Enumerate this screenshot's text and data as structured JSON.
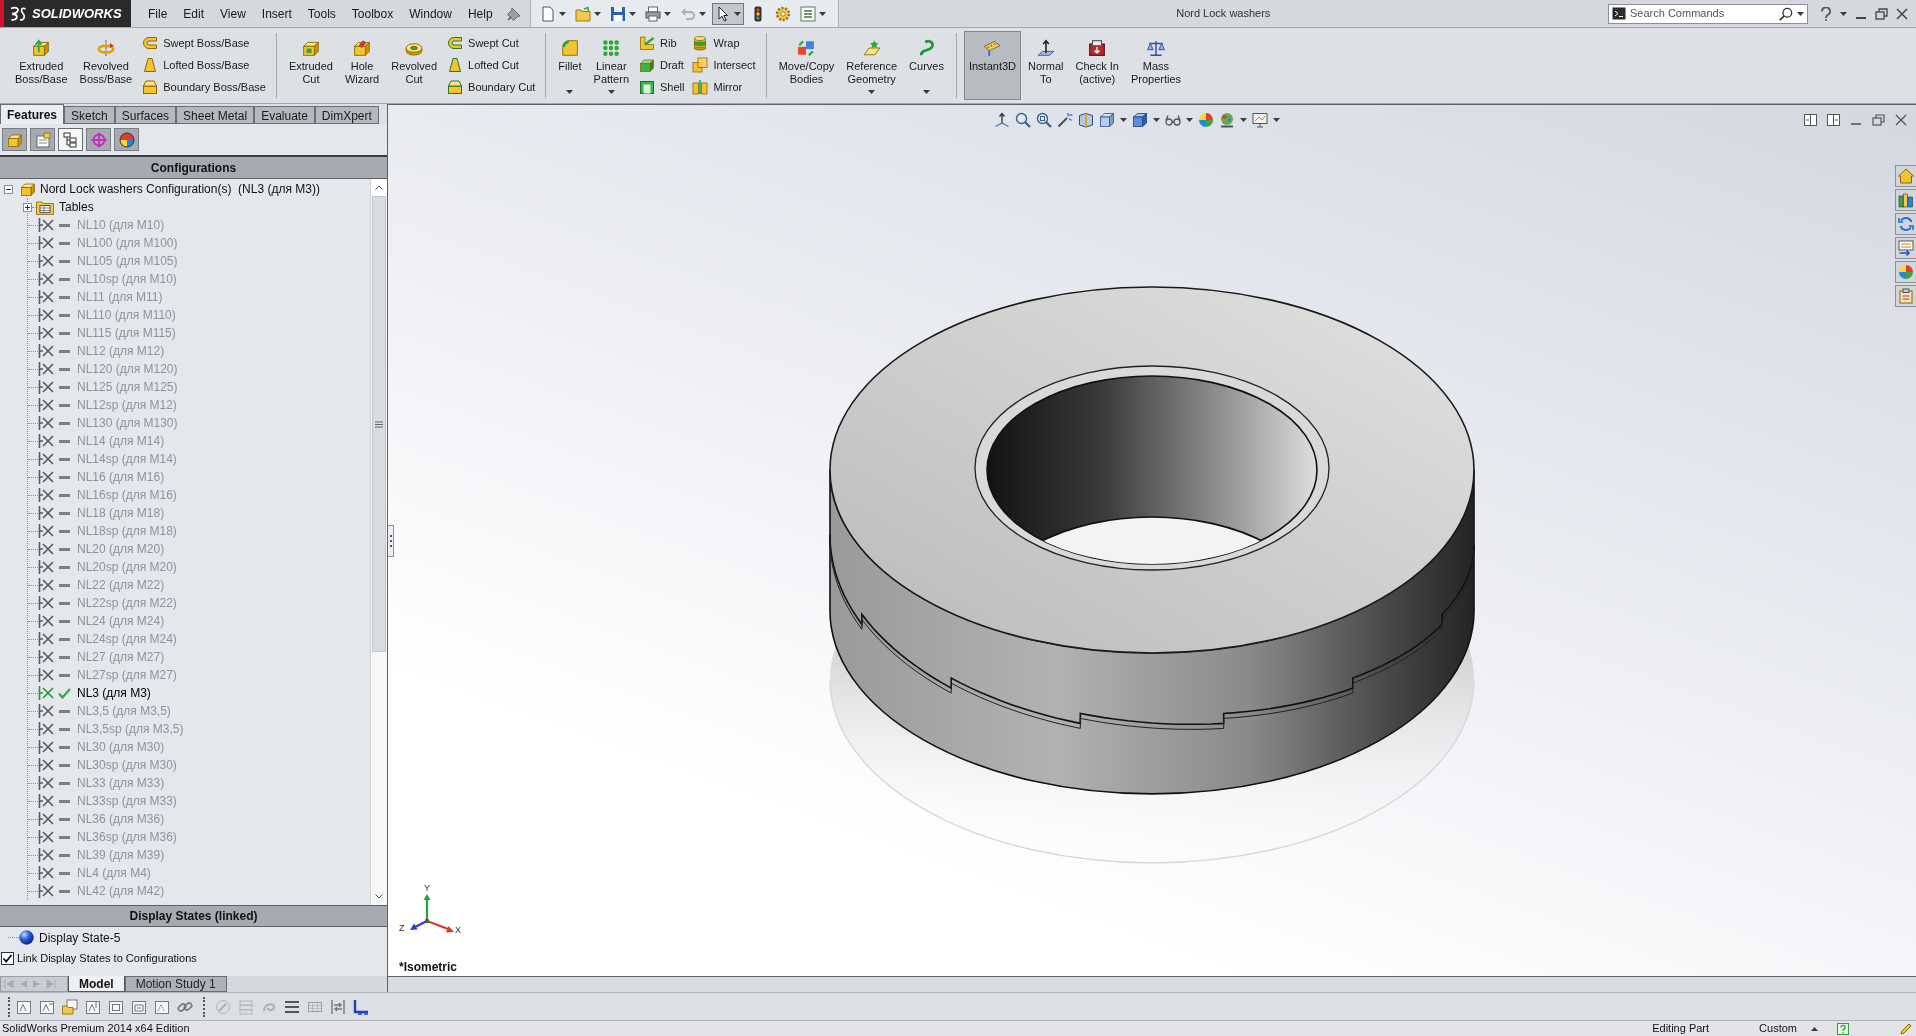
{
  "app": {
    "brand": "SOLIDWORKS",
    "title": "Nord Lock washers"
  },
  "menu": [
    "File",
    "Edit",
    "View",
    "Insert",
    "Tools",
    "Toolbox",
    "Window",
    "Help"
  ],
  "quick_access": [
    {
      "kind": "new",
      "dropdown": true,
      "pressed": false,
      "disabled": false
    },
    {
      "kind": "open",
      "dropdown": true,
      "pressed": false,
      "disabled": false
    },
    {
      "kind": "save",
      "dropdown": true,
      "pressed": false,
      "disabled": false
    },
    {
      "kind": "print",
      "dropdown": true,
      "pressed": false,
      "disabled": false
    },
    {
      "kind": "undo",
      "dropdown": true,
      "pressed": false,
      "disabled": true
    },
    {
      "kind": "select",
      "dropdown": true,
      "pressed": true,
      "disabled": false
    },
    {
      "kind": "rebuild",
      "dropdown": false,
      "pressed": false,
      "disabled": false
    },
    {
      "kind": "options",
      "dropdown": false,
      "pressed": false,
      "disabled": false
    },
    {
      "kind": "customize",
      "dropdown": true,
      "pressed": false,
      "disabled": false
    }
  ],
  "search": {
    "placeholder": "Search Commands"
  },
  "ribbon": {
    "groups": [
      [
        {
          "kind": "large",
          "label": "Extruded\nBoss/Base",
          "dropdown": false,
          "pressed": false
        },
        {
          "kind": "large",
          "label": "Revolved\nBoss/Base",
          "dropdown": false,
          "pressed": false
        },
        {
          "kind": "column",
          "items": [
            "Swept Boss/Base",
            "Lofted Boss/Base",
            "Boundary Boss/Base"
          ]
        }
      ],
      [
        {
          "kind": "large",
          "label": "Extruded\nCut",
          "dropdown": false,
          "pressed": false
        },
        {
          "kind": "large",
          "label": "Hole\nWizard",
          "dropdown": false,
          "pressed": false
        },
        {
          "kind": "large",
          "label": "Revolved\nCut",
          "dropdown": false,
          "pressed": false
        },
        {
          "kind": "column",
          "items": [
            "Swept Cut",
            "Lofted Cut",
            "Boundary Cut"
          ]
        }
      ],
      [
        {
          "kind": "large",
          "label": "Fillet",
          "dropdown": true,
          "pressed": false
        },
        {
          "kind": "large",
          "label": "Linear\nPattern",
          "dropdown": true,
          "pressed": false
        },
        {
          "kind": "column",
          "items": [
            "Rib",
            "Draft",
            "Shell"
          ]
        },
        {
          "kind": "column",
          "items": [
            "Wrap",
            "Intersect",
            "Mirror"
          ]
        }
      ],
      [
        {
          "kind": "large",
          "label": "Move/Copy\nBodies",
          "dropdown": false,
          "pressed": false
        },
        {
          "kind": "large",
          "label": "Reference\nGeometry",
          "dropdown": true,
          "pressed": false
        },
        {
          "kind": "large",
          "label": "Curves",
          "dropdown": true,
          "pressed": false
        }
      ],
      [
        {
          "kind": "large",
          "label": "Instant3D",
          "dropdown": false,
          "pressed": true
        },
        {
          "kind": "large",
          "label": "Normal\nTo",
          "dropdown": false,
          "pressed": false
        },
        {
          "kind": "large",
          "label": "Check In\n(active)",
          "dropdown": false,
          "pressed": false
        },
        {
          "kind": "large",
          "label": "Mass\nProperties",
          "dropdown": false,
          "pressed": false
        }
      ]
    ]
  },
  "command_tabs": [
    {
      "label": "Features",
      "selected": true
    },
    {
      "label": "Sketch",
      "selected": false
    },
    {
      "label": "Surfaces",
      "selected": false
    },
    {
      "label": "Sheet Metal",
      "selected": false
    },
    {
      "label": "Evaluate",
      "selected": false
    },
    {
      "label": "DimXpert",
      "selected": false
    }
  ],
  "manager_tabs": [
    {
      "kind": "feature_tree",
      "selected": false
    },
    {
      "kind": "properties",
      "selected": false
    },
    {
      "kind": "configurations",
      "selected": true
    },
    {
      "kind": "dimxpert",
      "selected": false
    },
    {
      "kind": "display",
      "selected": false
    }
  ],
  "configurations": {
    "title": "Configurations",
    "tree": {
      "label": "Nord Lock washers Configuration(s)  (NL3 (для M3))",
      "expanded": true,
      "children": [
        {
          "kind": "folder",
          "label": "Tables",
          "expanded": false
        },
        {
          "kind": "configuration",
          "label": "NL10 (для M10)",
          "active": false
        },
        {
          "kind": "configuration",
          "label": "NL100 (для M100)",
          "active": false
        },
        {
          "kind": "configuration",
          "label": "NL105 (для M105)",
          "active": false
        },
        {
          "kind": "configuration",
          "label": "NL10sp (для M10)",
          "active": false
        },
        {
          "kind": "configuration",
          "label": "NL11 (для M11)",
          "active": false
        },
        {
          "kind": "configuration",
          "label": "NL110 (для M110)",
          "active": false
        },
        {
          "kind": "configuration",
          "label": "NL115 (для M115)",
          "active": false
        },
        {
          "kind": "configuration",
          "label": "NL12 (для M12)",
          "active": false
        },
        {
          "kind": "configuration",
          "label": "NL120 (для M120)",
          "active": false
        },
        {
          "kind": "configuration",
          "label": "NL125 (для M125)",
          "active": false
        },
        {
          "kind": "configuration",
          "label": "NL12sp (для M12)",
          "active": false
        },
        {
          "kind": "configuration",
          "label": "NL130 (для M130)",
          "active": false
        },
        {
          "kind": "configuration",
          "label": "NL14 (для M14)",
          "active": false
        },
        {
          "kind": "configuration",
          "label": "NL14sp (для M14)",
          "active": false
        },
        {
          "kind": "configuration",
          "label": "NL16 (для M16)",
          "active": false
        },
        {
          "kind": "configuration",
          "label": "NL16sp (для M16)",
          "active": false
        },
        {
          "kind": "configuration",
          "label": "NL18 (для M18)",
          "active": false
        },
        {
          "kind": "configuration",
          "label": "NL18sp (для M18)",
          "active": false
        },
        {
          "kind": "configuration",
          "label": "NL20 (для M20)",
          "active": false
        },
        {
          "kind": "configuration",
          "label": "NL20sp (для M20)",
          "active": false
        },
        {
          "kind": "configuration",
          "label": "NL22 (для M22)",
          "active": false
        },
        {
          "kind": "configuration",
          "label": "NL22sp (для M22)",
          "active": false
        },
        {
          "kind": "configuration",
          "label": "NL24 (для M24)",
          "active": false
        },
        {
          "kind": "configuration",
          "label": "NL24sp (для M24)",
          "active": false
        },
        {
          "kind": "configuration",
          "label": "NL27 (для M27)",
          "active": false
        },
        {
          "kind": "configuration",
          "label": "NL27sp (для M27)",
          "active": false
        },
        {
          "kind": "configuration",
          "label": "NL3 (для M3)",
          "active": true
        },
        {
          "kind": "configuration",
          "label": "NL3,5 (для M3,5)",
          "active": false
        },
        {
          "kind": "configuration",
          "label": "NL3,5sp (для M3,5)",
          "active": false
        },
        {
          "kind": "configuration",
          "label": "NL30 (для M30)",
          "active": false
        },
        {
          "kind": "configuration",
          "label": "NL30sp (для M30)",
          "active": false
        },
        {
          "kind": "configuration",
          "label": "NL33 (для M33)",
          "active": false
        },
        {
          "kind": "configuration",
          "label": "NL33sp (для M33)",
          "active": false
        },
        {
          "kind": "configuration",
          "label": "NL36 (для M36)",
          "active": false
        },
        {
          "kind": "configuration",
          "label": "NL36sp (для M36)",
          "active": false
        },
        {
          "kind": "configuration",
          "label": "NL39 (для M39)",
          "active": false
        },
        {
          "kind": "configuration",
          "label": "NL4 (для M4)",
          "active": false
        },
        {
          "kind": "configuration",
          "label": "NL42 (для M42)",
          "active": false
        }
      ]
    }
  },
  "display_states": {
    "title": "Display States (linked)",
    "items": [
      "Display State-5"
    ],
    "link": {
      "label": "Link Display States to Configurations",
      "checked": true
    }
  },
  "bottom_tabs": [
    {
      "label": "Model",
      "selected": true
    },
    {
      "label": "Motion Study 1",
      "selected": false
    }
  ],
  "viewport": {
    "view_label": "*Isometric",
    "triad": [
      "Y",
      "Z",
      "X"
    ]
  },
  "status_bar": {
    "edition": "SolidWorks Premium 2014 x64 Edition",
    "mode": "Editing Part",
    "units": "Custom"
  }
}
